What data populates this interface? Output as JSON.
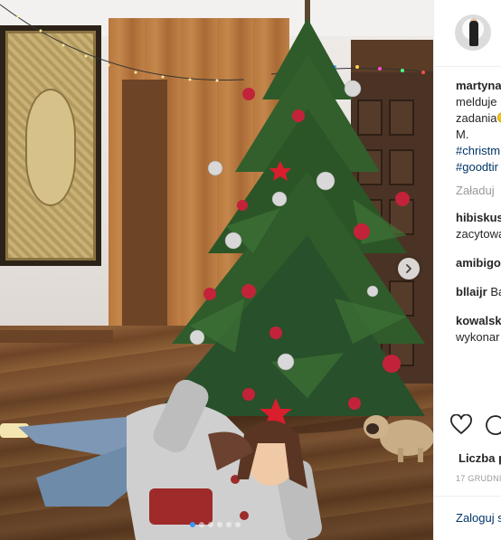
{
  "post": {
    "username": "martyna",
    "caption_lines": [
      "melduje",
      "zadania",
      "M."
    ],
    "hashtags": [
      "#christm",
      "#goodtir"
    ],
    "load_more": "Załaduj",
    "comments": [
      {
        "user": "hibiskus",
        "text": "zacytowa"
      },
      {
        "user": "amibigo",
        "text": ""
      },
      {
        "user": "bllaijr",
        "text": "Ba"
      },
      {
        "user": "kowalsk",
        "text": "wykonar"
      }
    ],
    "likes_label": "Liczba p",
    "date": "17 GRUDNI",
    "login_label": "Zaloguj s"
  },
  "carousel": {
    "slide_count": 6,
    "active_index": 0
  },
  "icons": {
    "like": "heart-icon",
    "comment": "comment-icon",
    "next": "chevron-right-icon"
  },
  "colors": {
    "link": "#003569",
    "active_dot": "#3897f0",
    "muted": "#999999"
  }
}
